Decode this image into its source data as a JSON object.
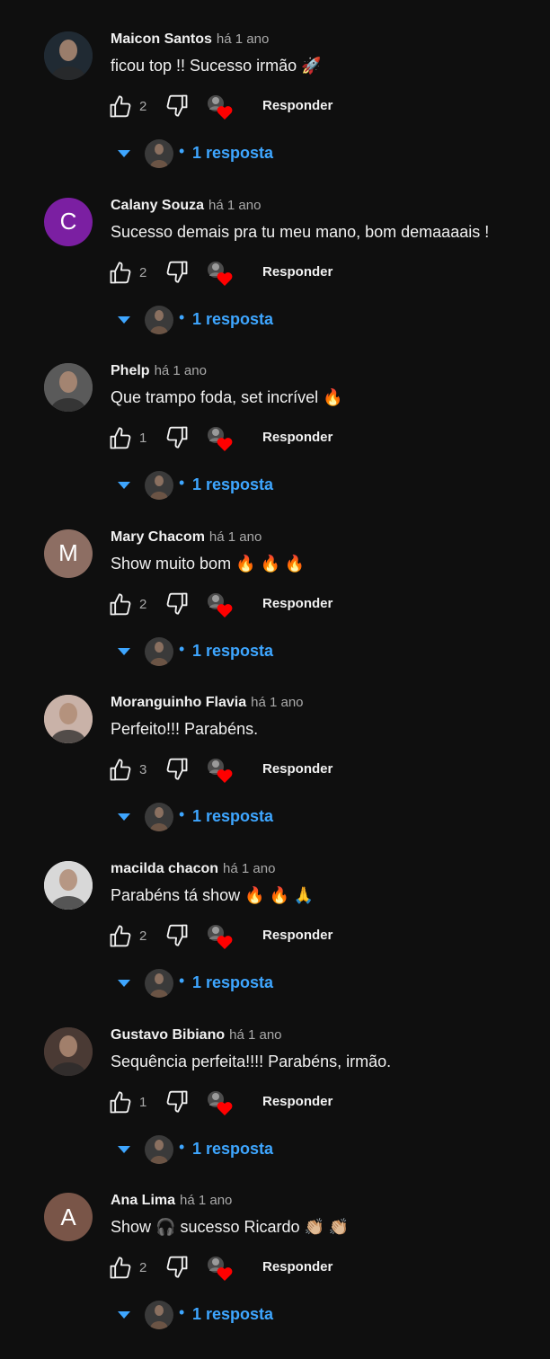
{
  "colors": {
    "background": "#0f0f0f",
    "text": "#f1f1f1",
    "secondary_text": "#aaaaaa",
    "link_blue": "#3ea6ff",
    "heart_red": "#ff0000"
  },
  "comments": [
    {
      "author": "Maicon Santos",
      "time": "há 1 ano",
      "text": "ficou top !! Sucesso irmão  🚀",
      "likes": "2",
      "reply_label": "Responder",
      "replies_label": "1 resposta",
      "avatar_type": "photo",
      "avatar_letter": "",
      "avatar_color": "#202a33"
    },
    {
      "author": "Calany Souza",
      "time": "há 1 ano",
      "text": "Sucesso demais pra tu meu mano, bom demaaaais !",
      "likes": "2",
      "reply_label": "Responder",
      "replies_label": "1 resposta",
      "avatar_type": "letter",
      "avatar_letter": "C",
      "avatar_color": "#7b1fa2"
    },
    {
      "author": "Phelp",
      "time": "há 1 ano",
      "text": "Que trampo foda, set incrível  🔥",
      "likes": "1",
      "reply_label": "Responder",
      "replies_label": "1 resposta",
      "avatar_type": "photo",
      "avatar_letter": "",
      "avatar_color": "#5a5a5a"
    },
    {
      "author": "Mary Chacom",
      "time": "há 1 ano",
      "text": "Show muito bom  🔥 🔥 🔥",
      "likes": "2",
      "reply_label": "Responder",
      "replies_label": "1 resposta",
      "avatar_type": "letter",
      "avatar_letter": "M",
      "avatar_color": "#8d6e63"
    },
    {
      "author": "Moranguinho Flavia",
      "time": "há 1 ano",
      "text": "Perfeito!!! Parabéns.",
      "likes": "3",
      "reply_label": "Responder",
      "replies_label": "1 resposta",
      "avatar_type": "photo",
      "avatar_letter": "",
      "avatar_color": "#c9b2a8"
    },
    {
      "author": "macilda chacon",
      "time": "há 1 ano",
      "text": "Parabéns tá show 🔥 🔥 🙏",
      "likes": "2",
      "reply_label": "Responder",
      "replies_label": "1 resposta",
      "avatar_type": "photo",
      "avatar_letter": "",
      "avatar_color": "#d8d8d8"
    },
    {
      "author": "Gustavo Bibiano",
      "time": "há 1 ano",
      "text": "Sequência perfeita!!!! Parabéns, irmão.",
      "likes": "1",
      "reply_label": "Responder",
      "replies_label": "1 resposta",
      "avatar_type": "photo",
      "avatar_letter": "",
      "avatar_color": "#4a3a34"
    },
    {
      "author": "Ana Lima",
      "time": "há 1 ano",
      "text": "Show 🎧 sucesso Ricardo 👏🏼 👏🏼",
      "likes": "2",
      "reply_label": "Responder",
      "replies_label": "1 resposta",
      "avatar_type": "letter",
      "avatar_letter": "A",
      "avatar_color": "#795548"
    }
  ]
}
